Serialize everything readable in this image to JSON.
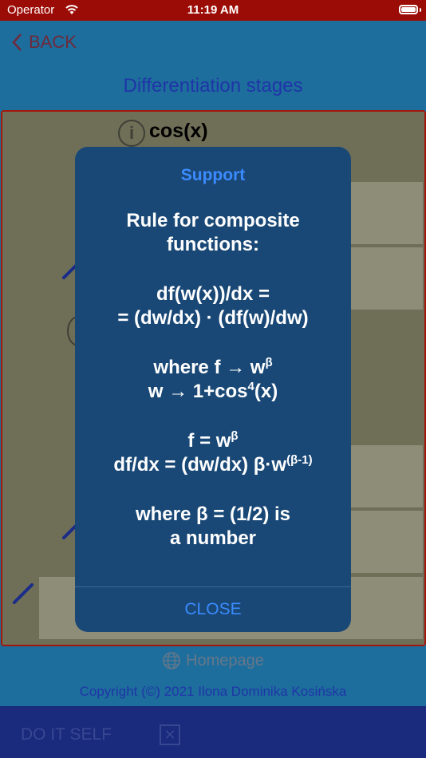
{
  "status_bar": {
    "carrier": "Operator",
    "time": "11:19 AM"
  },
  "nav": {
    "back_label": "BACK",
    "title": "Differentiation stages"
  },
  "content": {
    "function_label": "cos(x)"
  },
  "modal": {
    "title": "Support",
    "rule_heading": [
      "Rule for composite",
      "functions:"
    ],
    "derivative_rule": [
      "df(w(x))/dx =",
      "= (dw/dx) · (df(w)/dw)"
    ],
    "where_f_prefix": "where f → w",
    "where_f_sup": "β",
    "w_def_prefix": "w → 1+cos",
    "w_def_sup": "4",
    "w_def_suffix": "(x)",
    "f_def_prefix": "f = w",
    "f_def_sup": "β",
    "dfdx_prefix": "df/dx = (dw/dx) β·w",
    "dfdx_sup": "(β-1)",
    "beta_note": [
      "where β = (1/2) is",
      "a number"
    ],
    "close_label": "CLOSE"
  },
  "footer": {
    "homepage_label": "Homepage",
    "copyright": "Copyright (©) 2021 Ilona Dominika Kosińska"
  },
  "toolbar": {
    "do_it_self_label": "DO IT SELF"
  }
}
